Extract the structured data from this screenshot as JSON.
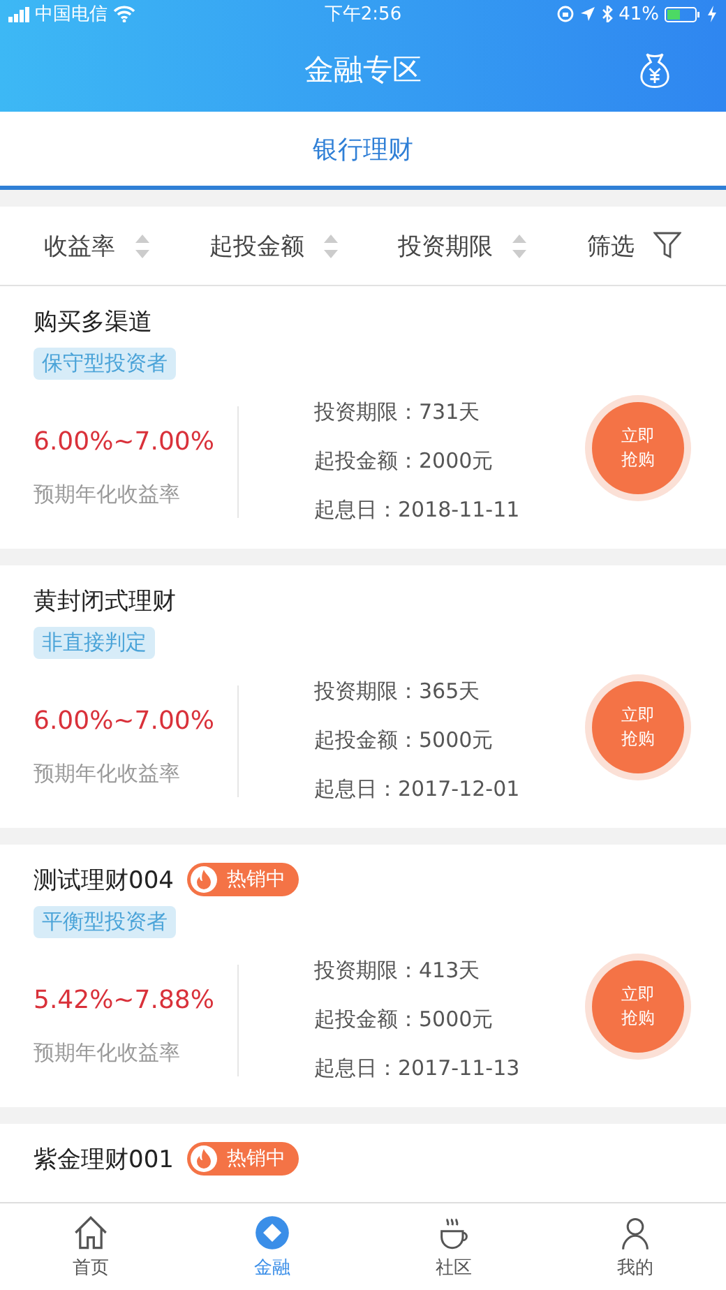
{
  "status_bar": {
    "carrier": "中国电信",
    "time": "下午2:56",
    "battery": "41%"
  },
  "nav": {
    "title": "金融专区"
  },
  "segment": {
    "label": "银行理财",
    "selected": true
  },
  "filters": [
    {
      "label": "收益率",
      "kind": "sort"
    },
    {
      "label": "起投金额",
      "kind": "sort"
    },
    {
      "label": "投资期限",
      "kind": "sort"
    },
    {
      "label": "筛选",
      "kind": "filter"
    }
  ],
  "products": [
    {
      "name": "购买多渠道",
      "tag": "保守型投资者",
      "rate": "6.00%~7.00%",
      "rate_label": "预期年化收益率",
      "term": "投资期限：731天",
      "min_amount": "起投金额：2000元",
      "start_date": "起息日：2018-11-11",
      "button": "立即抢购"
    },
    {
      "name": "黄封闭式理财",
      "tag": "非直接判定",
      "rate": "6.00%~7.00%",
      "rate_label": "预期年化收益率",
      "term": "投资期限：365天",
      "min_amount": "起投金额：5000元",
      "start_date": "起息日：2017-12-01",
      "button": "立即抢购"
    },
    {
      "name": "测试理财004",
      "badge": "热销中",
      "tag": "平衡型投资者",
      "rate": "5.42%~7.88%",
      "rate_label": "预期年化收益率",
      "term": "投资期限：413天",
      "min_amount": "起投金额：5000元",
      "start_date": "起息日：2017-11-13",
      "button": "立即抢购"
    },
    {
      "name": "紫金理财001",
      "badge": "热销中"
    }
  ],
  "tab_bar": [
    {
      "label": "首页",
      "kind": "home",
      "selected": false
    },
    {
      "label": "金融",
      "kind": "finance",
      "selected": true
    },
    {
      "label": "社区",
      "kind": "cup",
      "selected": false
    },
    {
      "label": "我的",
      "kind": "person",
      "selected": false
    }
  ]
}
